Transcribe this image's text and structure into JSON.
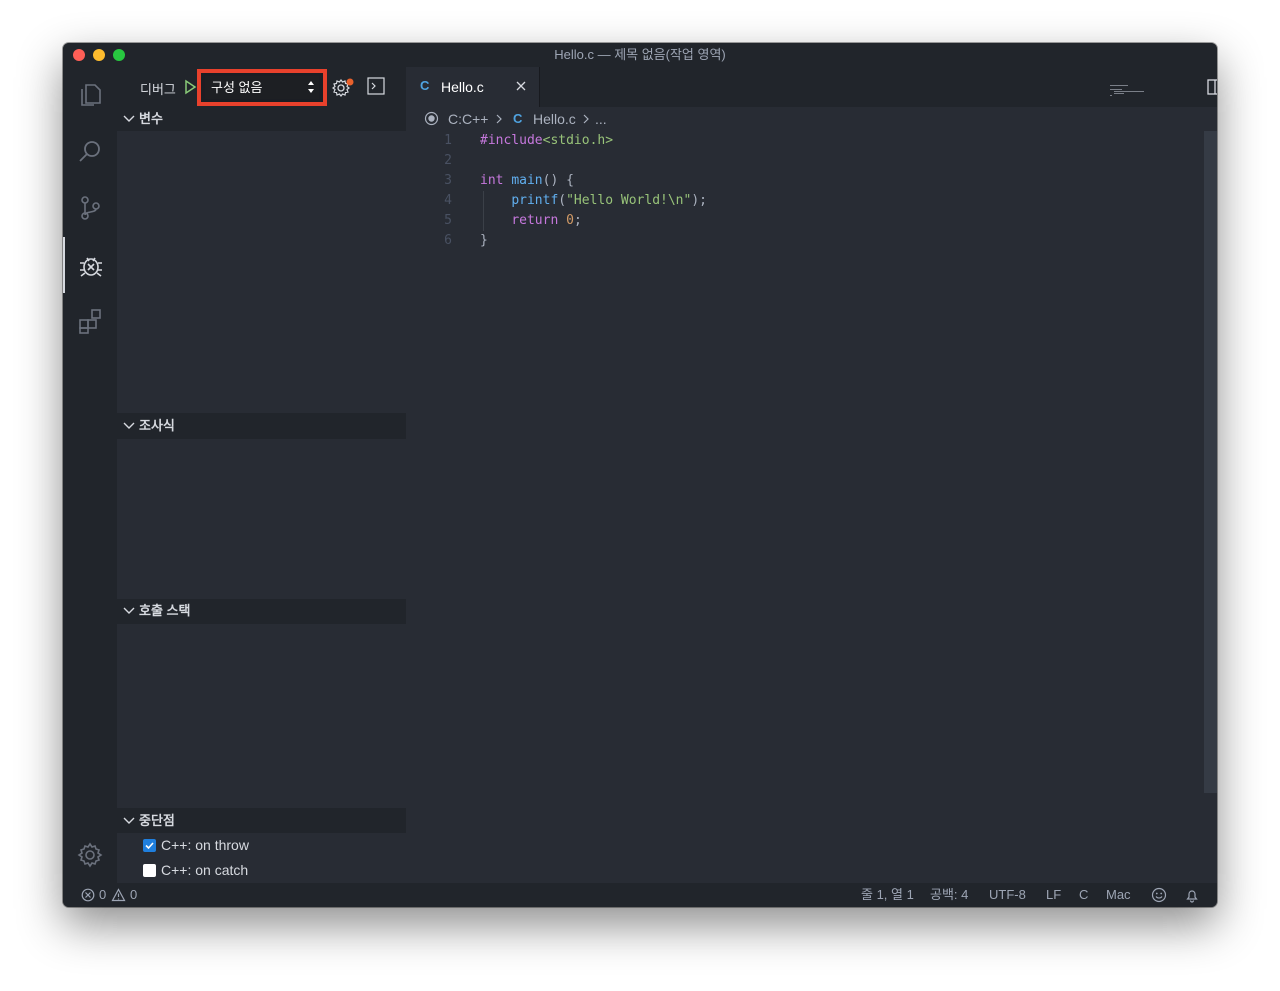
{
  "window": {
    "title": "Hello.c — 제목 없음(작업 영역)"
  },
  "activity_bar": {
    "items": [
      "explorer-icon",
      "search-icon",
      "source-control-icon",
      "debug-icon",
      "extensions-icon"
    ],
    "active": "debug-icon",
    "bottom": "gear-icon"
  },
  "debug": {
    "label": "디버그",
    "config_value": "구성 없음",
    "highlight_color": "#e8412c"
  },
  "sections": {
    "variables": "변수",
    "watch": "조사식",
    "call_stack": "호출 스택",
    "breakpoints": "중단점"
  },
  "breakpoints": [
    {
      "label": "C++: on throw",
      "checked": true
    },
    {
      "label": "C++: on catch",
      "checked": false
    }
  ],
  "tab": {
    "icon_letter": "C",
    "label": "Hello.c"
  },
  "breadcrumb": {
    "folder": "C:C++",
    "file_icon": "C",
    "file": "Hello.c",
    "more": "..."
  },
  "editor": {
    "line_numbers": [
      "1",
      "2",
      "3",
      "4",
      "5",
      "6"
    ],
    "lines": [
      "#include<stdio.h>",
      "",
      "int main() {",
      "    printf(\"Hello World!\\n\");",
      "    return 0;",
      "}"
    ]
  },
  "status": {
    "errors": "0",
    "warnings": "0",
    "position": "줄 1, 열 1",
    "spaces": "공백: 4",
    "encoding": "UTF-8",
    "eol": "LF",
    "language": "C",
    "platform": "Mac"
  }
}
